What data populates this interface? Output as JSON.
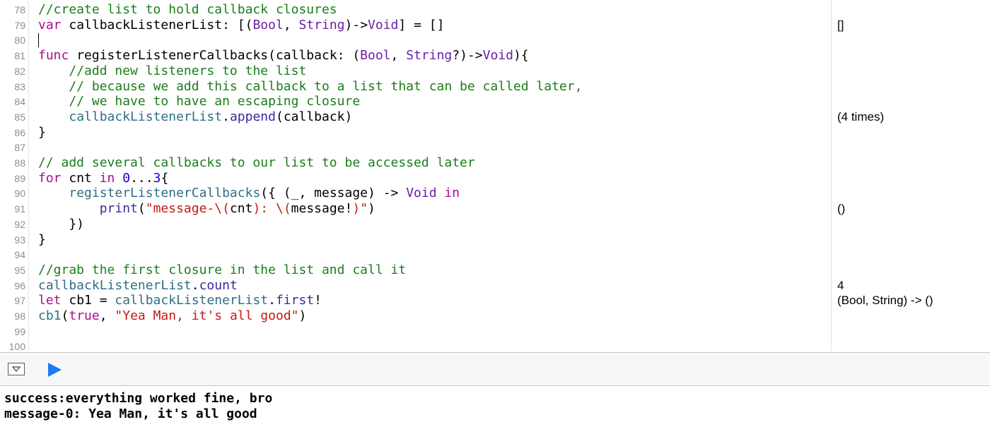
{
  "editor": {
    "lines": [
      {
        "number": "78",
        "tokens": [
          [
            "comment",
            "//create list to hold callback closures"
          ]
        ]
      },
      {
        "number": "79",
        "tokens": [
          [
            "keyword",
            "var"
          ],
          [
            "plain",
            " callbackListenerList: [("
          ],
          [
            "type",
            "Bool"
          ],
          [
            "plain",
            ", "
          ],
          [
            "type",
            "String"
          ],
          [
            "plain",
            ")->"
          ],
          [
            "type",
            "Void"
          ],
          [
            "plain",
            "] = []"
          ]
        ]
      },
      {
        "number": "80",
        "tokens": [],
        "caret": true
      },
      {
        "number": "81",
        "tokens": [
          [
            "keyword",
            "func"
          ],
          [
            "plain",
            " registerListenerCallbacks(callback: ("
          ],
          [
            "type",
            "Bool"
          ],
          [
            "plain",
            ", "
          ],
          [
            "type",
            "String"
          ],
          [
            "plain",
            "?)->"
          ],
          [
            "type",
            "Void"
          ],
          [
            "plain",
            "){"
          ]
        ]
      },
      {
        "number": "82",
        "tokens": [
          [
            "plain",
            "    "
          ],
          [
            "comment",
            "//add new listeners to the list"
          ]
        ]
      },
      {
        "number": "83",
        "tokens": [
          [
            "plain",
            "    "
          ],
          [
            "comment",
            "// because we add this callback to a list that can be called later,"
          ]
        ]
      },
      {
        "number": "84",
        "tokens": [
          [
            "plain",
            "    "
          ],
          [
            "comment",
            "// we have to have an escaping closure"
          ]
        ]
      },
      {
        "number": "85",
        "tokens": [
          [
            "plain",
            "    "
          ],
          [
            "ident",
            "callbackListenerList"
          ],
          [
            "plain",
            "."
          ],
          [
            "method",
            "append"
          ],
          [
            "plain",
            "(callback)"
          ]
        ]
      },
      {
        "number": "86",
        "tokens": [
          [
            "plain",
            "}"
          ]
        ]
      },
      {
        "number": "87",
        "tokens": []
      },
      {
        "number": "88",
        "tokens": [
          [
            "comment",
            "// add several callbacks to our list to be accessed later"
          ]
        ]
      },
      {
        "number": "89",
        "tokens": [
          [
            "keyword",
            "for"
          ],
          [
            "plain",
            " cnt "
          ],
          [
            "keyword",
            "in"
          ],
          [
            "plain",
            " "
          ],
          [
            "number",
            "0"
          ],
          [
            "plain",
            "..."
          ],
          [
            "number",
            "3"
          ],
          [
            "plain",
            "{"
          ]
        ]
      },
      {
        "number": "90",
        "tokens": [
          [
            "plain",
            "    "
          ],
          [
            "ident",
            "registerListenerCallbacks"
          ],
          [
            "plain",
            "({ (_, message) -> "
          ],
          [
            "type",
            "Void"
          ],
          [
            "plain",
            " "
          ],
          [
            "keyword",
            "in"
          ]
        ]
      },
      {
        "number": "91",
        "tokens": [
          [
            "plain",
            "        "
          ],
          [
            "method",
            "print"
          ],
          [
            "plain",
            "("
          ],
          [
            "string",
            "\"message-\\("
          ],
          [
            "plain",
            "cnt"
          ],
          [
            "string",
            "): \\("
          ],
          [
            "plain",
            "message!"
          ],
          [
            "string",
            ")\""
          ],
          [
            "plain",
            ")"
          ]
        ]
      },
      {
        "number": "92",
        "tokens": [
          [
            "plain",
            "    })"
          ]
        ]
      },
      {
        "number": "93",
        "tokens": [
          [
            "plain",
            "}"
          ]
        ]
      },
      {
        "number": "94",
        "tokens": []
      },
      {
        "number": "95",
        "tokens": [
          [
            "comment",
            "//grab the first closure in the list and call it"
          ]
        ]
      },
      {
        "number": "96",
        "tokens": [
          [
            "ident",
            "callbackListenerList"
          ],
          [
            "plain",
            "."
          ],
          [
            "method",
            "count"
          ]
        ]
      },
      {
        "number": "97",
        "tokens": [
          [
            "keyword",
            "let"
          ],
          [
            "plain",
            " cb1 = "
          ],
          [
            "ident",
            "callbackListenerList"
          ],
          [
            "plain",
            "."
          ],
          [
            "method",
            "first"
          ],
          [
            "plain",
            "!"
          ]
        ]
      },
      {
        "number": "98",
        "tokens": [
          [
            "ident",
            "cb1"
          ],
          [
            "plain",
            "("
          ],
          [
            "keyword",
            "true"
          ],
          [
            "plain",
            ", "
          ],
          [
            "string",
            "\"Yea Man, it's all good\""
          ],
          [
            "plain",
            ")"
          ]
        ]
      },
      {
        "number": "99",
        "tokens": []
      },
      {
        "number": "100",
        "tokens": []
      }
    ]
  },
  "results": [
    {
      "line_index": 1,
      "text": "[]"
    },
    {
      "line_index": 7,
      "text": "(4 times)"
    },
    {
      "line_index": 13,
      "text": "()"
    },
    {
      "line_index": 18,
      "text": "4"
    },
    {
      "line_index": 19,
      "text": "(Bool, String) -> ()"
    }
  ],
  "debug_bar": {
    "hide_debug_icon": "hide-debug-area-icon",
    "run_icon": "play-icon",
    "run_color": "#1a7cf0"
  },
  "console": {
    "lines": [
      "success:everything worked fine, bro",
      "message-0: Yea Man, it's all good"
    ]
  }
}
